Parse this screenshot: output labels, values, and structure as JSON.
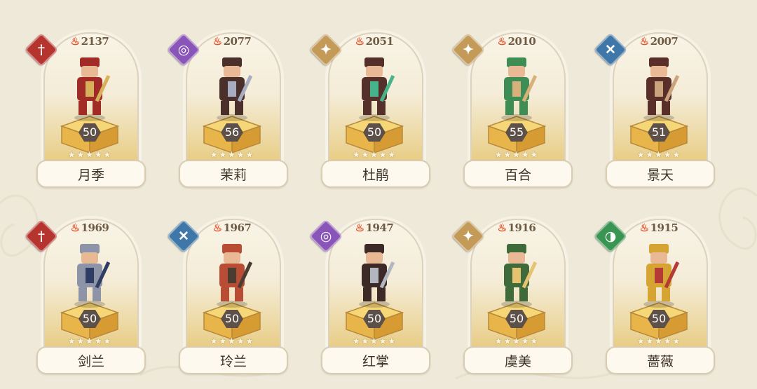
{
  "heroes": [
    {
      "name": "月季",
      "power": "2137",
      "level": "50",
      "stars": "★★★★★",
      "element": "red",
      "glyph": "†",
      "icon": "sword-element-icon",
      "outfit": "#a12b27",
      "accent": "#d7b25a"
    },
    {
      "name": "茉莉",
      "power": "2077",
      "level": "56",
      "stars": "★★★★★",
      "element": "purple",
      "glyph": "◎",
      "icon": "arcane-element-icon",
      "outfit": "#4a2f2a",
      "accent": "#a8acc0"
    },
    {
      "name": "杜鹃",
      "power": "2051",
      "level": "50",
      "stars": "★★★★★",
      "element": "gold",
      "glyph": "✦",
      "icon": "star-element-icon",
      "outfit": "#55302b",
      "accent": "#46b38b"
    },
    {
      "name": "百合",
      "power": "2010",
      "level": "55",
      "stars": "★★★★★",
      "element": "gold",
      "glyph": "✦",
      "icon": "star-element-icon",
      "outfit": "#3e8d55",
      "accent": "#d8b07a"
    },
    {
      "name": "景天",
      "power": "2007",
      "level": "51",
      "stars": "★★★★★",
      "element": "blue",
      "glyph": "✕",
      "icon": "wind-element-icon",
      "outfit": "#5a2e29",
      "accent": "#c9a47d"
    },
    {
      "name": "剑兰",
      "power": "1969",
      "level": "50",
      "stars": "★★★★★",
      "element": "red",
      "glyph": "†",
      "icon": "sword-element-icon",
      "outfit": "#8d94a7",
      "accent": "#2f3c63"
    },
    {
      "name": "玲兰",
      "power": "1967",
      "level": "50",
      "stars": "★★★★★",
      "element": "blue",
      "glyph": "✕",
      "icon": "wind-element-icon",
      "outfit": "#b84c35",
      "accent": "#4a3c31"
    },
    {
      "name": "红掌",
      "power": "1947",
      "level": "50",
      "stars": "★★★★★",
      "element": "purple",
      "glyph": "◎",
      "icon": "arcane-element-icon",
      "outfit": "#3d2a26",
      "accent": "#b2b6bf"
    },
    {
      "name": "虞美",
      "power": "1916",
      "level": "50",
      "stars": "★★★★★",
      "element": "gold",
      "glyph": "✦",
      "icon": "star-element-icon",
      "outfit": "#3f6b3a",
      "accent": "#e6c371"
    },
    {
      "name": "蔷薇",
      "power": "1915",
      "level": "50",
      "stars": "★★★★★",
      "element": "green",
      "glyph": "◑",
      "icon": "shield-element-icon",
      "outfit": "#d6a433",
      "accent": "#b53a36"
    }
  ]
}
